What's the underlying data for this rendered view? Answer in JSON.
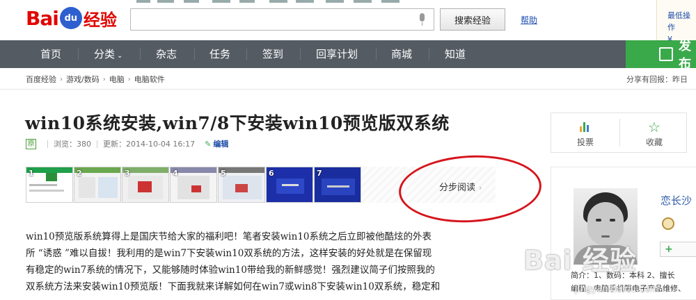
{
  "header": {
    "logo_bai": "Bai",
    "logo_du": "du",
    "logo_jingyan": "经验",
    "search_value": "",
    "search_button": "搜索经验",
    "help_link": "帮助",
    "promo_line1": "最低操作",
    "promo_line2": "¥"
  },
  "nav": {
    "items": [
      {
        "label": "首页"
      },
      {
        "label": "分类"
      },
      {
        "label": "杂志"
      },
      {
        "label": "任务"
      },
      {
        "label": "签到"
      },
      {
        "label": "回享计划"
      },
      {
        "label": "商城"
      },
      {
        "label": "知道"
      }
    ],
    "caret": "⌄",
    "publish_label": "发布"
  },
  "breadcrumb": {
    "items": [
      "百度经验",
      "游戏/数码",
      "电脑",
      "电脑软件"
    ],
    "arrow": "›",
    "share_text": "分享有回报：昨日"
  },
  "article": {
    "title": "win10系统安装,win7/8下安装win10预览版双系统",
    "original_badge": "原",
    "views": "浏览：380",
    "updated": "更新：2014-10-04 16:17",
    "edit_label": "编辑",
    "step_count_labels": [
      "1",
      "2",
      "3",
      "4",
      "5",
      "6",
      "7"
    ],
    "step_read_label": "分步阅读",
    "step_read_chevron": "›",
    "paragraph_lines": [
      "win10预览版系统算得上是国庆节给大家的福利吧！笔者安装win10系统之后立即被他酷炫的外表",
      "所 “诱惑 ”难以自拔！我利用的是win7下安装win10双系统的方法，这样安装的好处就是在保留现",
      "有稳定的win7系统的情况下，又能够随时体验win10带给我的新鲜感觉！强烈建议简子们按照我的",
      "双系统方法来安装win10预览版！下面我就来详解如何在win7或win8下安装win10双系统，稳定和"
    ]
  },
  "sidebar": {
    "vote_label": "投票",
    "collect_label": "收藏",
    "author_name": "恋长沙",
    "follow_label": "+",
    "intro_line1": "简介：1、数码：本科 2、擅长",
    "intro_line2": "编程、电脑手机等电子产品维修、"
  },
  "watermark": {
    "main": "Bai 经验",
    "sub": "jingyan.baidu.com"
  },
  "colors": {
    "brand_red": "#e10602",
    "brand_blue": "#2d5fcf",
    "nav_bg": "#545b63",
    "publish_green": "#3aa94a",
    "link_blue": "#1d4ca8",
    "annotation_red": "#d6141b"
  },
  "icons": {
    "mic": "microphone-icon",
    "vote": "bar-chart-icon",
    "collect": "star-icon",
    "publish": "pen-icon",
    "badge": "level-badge-icon"
  }
}
